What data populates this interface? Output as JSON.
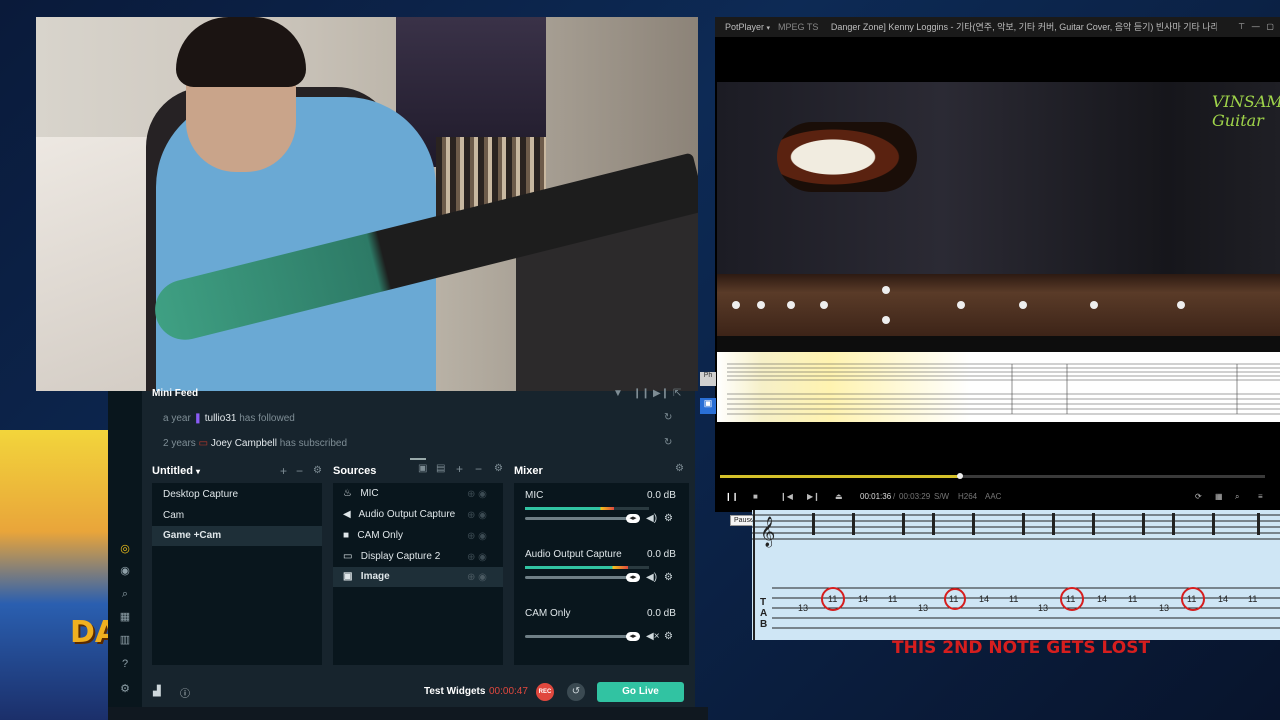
{
  "feed": {
    "title": "Mini Feed",
    "rows": [
      {
        "time": "a year",
        "user": "tullio31",
        "action": "has followed"
      },
      {
        "time": "2 years",
        "user": "Joey Campbell",
        "action": "has subscribed"
      }
    ]
  },
  "scenes": {
    "title": "Untitled",
    "items": [
      "Desktop Capture",
      "Cam",
      "Game +Cam"
    ],
    "selected": 2
  },
  "sources": {
    "title": "Sources",
    "items": [
      "MIC",
      "Audio Output Capture",
      "CAM Only",
      "Display Capture 2",
      "Image"
    ],
    "selected": 4
  },
  "mixer": {
    "title": "Mixer",
    "channels": [
      {
        "name": "MIC",
        "db": "0.0 dB",
        "level": 0.72
      },
      {
        "name": "Audio Output Capture",
        "db": "0.0 dB",
        "level": 0.83
      },
      {
        "name": "CAM Only",
        "db": "0.0 dB",
        "level": 0
      }
    ]
  },
  "footer": {
    "test_widgets": "Test Widgets",
    "timer": "00:00:47",
    "rec": "REC",
    "go_live": "Go Live"
  },
  "player": {
    "app": "PotPlayer",
    "format": "MPEG TS",
    "title": "Danger Zone] Kenny Loggins - 기타(연주, 악보, 기타 커버, Guitar Cover, 음악 듣기) 빈사마 기타 나라(1:",
    "current": "00:01:36",
    "total": "00:03:29",
    "progress": 0.44,
    "tags": [
      "S/W",
      "H264",
      "AAC"
    ],
    "tooltip": "Pause",
    "logo": "VINSAM Guitar"
  },
  "tab_caption": "THIS 2ND NOTE GETS LOST",
  "art_text": "DA",
  "colors": {
    "accent": "#31c3a2",
    "rec": "#e0483e",
    "caption": "#d61e1e"
  }
}
